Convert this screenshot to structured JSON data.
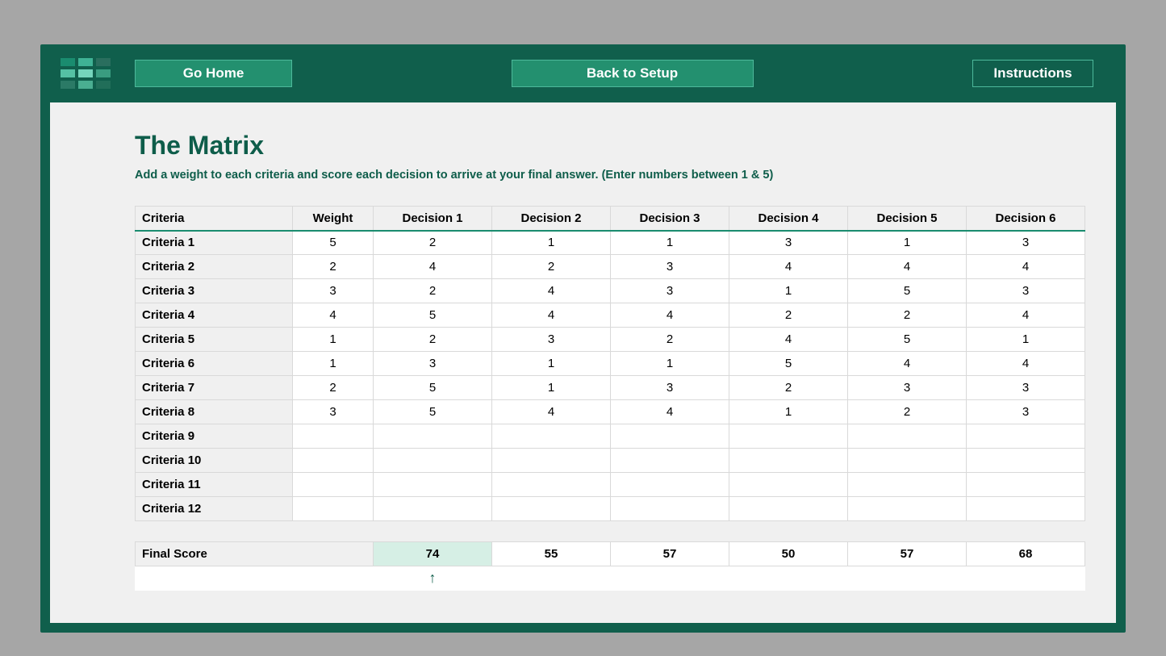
{
  "topbar": {
    "go_home": "Go Home",
    "back_to_setup": "Back to Setup",
    "instructions": "Instructions"
  },
  "page": {
    "title": "The Matrix",
    "subtitle": "Add a weight to each criteria and score each decision to arrive at your final answer. (Enter numbers between 1 & 5)"
  },
  "headers": {
    "criteria": "Criteria",
    "weight": "Weight",
    "decisions": [
      "Decision 1",
      "Decision 2",
      "Decision 3",
      "Decision 4",
      "Decision 5",
      "Decision 6"
    ]
  },
  "rows": [
    {
      "name": "Criteria 1",
      "weight": "5",
      "scores": [
        "2",
        "1",
        "1",
        "3",
        "1",
        "3"
      ]
    },
    {
      "name": "Criteria 2",
      "weight": "2",
      "scores": [
        "4",
        "2",
        "3",
        "4",
        "4",
        "4"
      ]
    },
    {
      "name": "Criteria 3",
      "weight": "3",
      "scores": [
        "2",
        "4",
        "3",
        "1",
        "5",
        "3"
      ]
    },
    {
      "name": "Criteria 4",
      "weight": "4",
      "scores": [
        "5",
        "4",
        "4",
        "2",
        "2",
        "4"
      ]
    },
    {
      "name": "Criteria 5",
      "weight": "1",
      "scores": [
        "2",
        "3",
        "2",
        "4",
        "5",
        "1"
      ]
    },
    {
      "name": "Criteria 6",
      "weight": "1",
      "scores": [
        "3",
        "1",
        "1",
        "5",
        "4",
        "4"
      ]
    },
    {
      "name": "Criteria 7",
      "weight": "2",
      "scores": [
        "5",
        "1",
        "3",
        "2",
        "3",
        "3"
      ]
    },
    {
      "name": "Criteria 8",
      "weight": "3",
      "scores": [
        "5",
        "4",
        "4",
        "1",
        "2",
        "3"
      ]
    },
    {
      "name": "Criteria 9",
      "weight": "",
      "scores": [
        "",
        "",
        "",
        "",
        "",
        ""
      ]
    },
    {
      "name": "Criteria 10",
      "weight": "",
      "scores": [
        "",
        "",
        "",
        "",
        "",
        ""
      ]
    },
    {
      "name": "Criteria 11",
      "weight": "",
      "scores": [
        "",
        "",
        "",
        "",
        "",
        ""
      ]
    },
    {
      "name": "Criteria 12",
      "weight": "",
      "scores": [
        "",
        "",
        "",
        "",
        "",
        ""
      ]
    }
  ],
  "final": {
    "label": "Final Score",
    "scores": [
      "74",
      "55",
      "57",
      "50",
      "57",
      "68"
    ],
    "best_index": 0,
    "arrow": "↑"
  }
}
